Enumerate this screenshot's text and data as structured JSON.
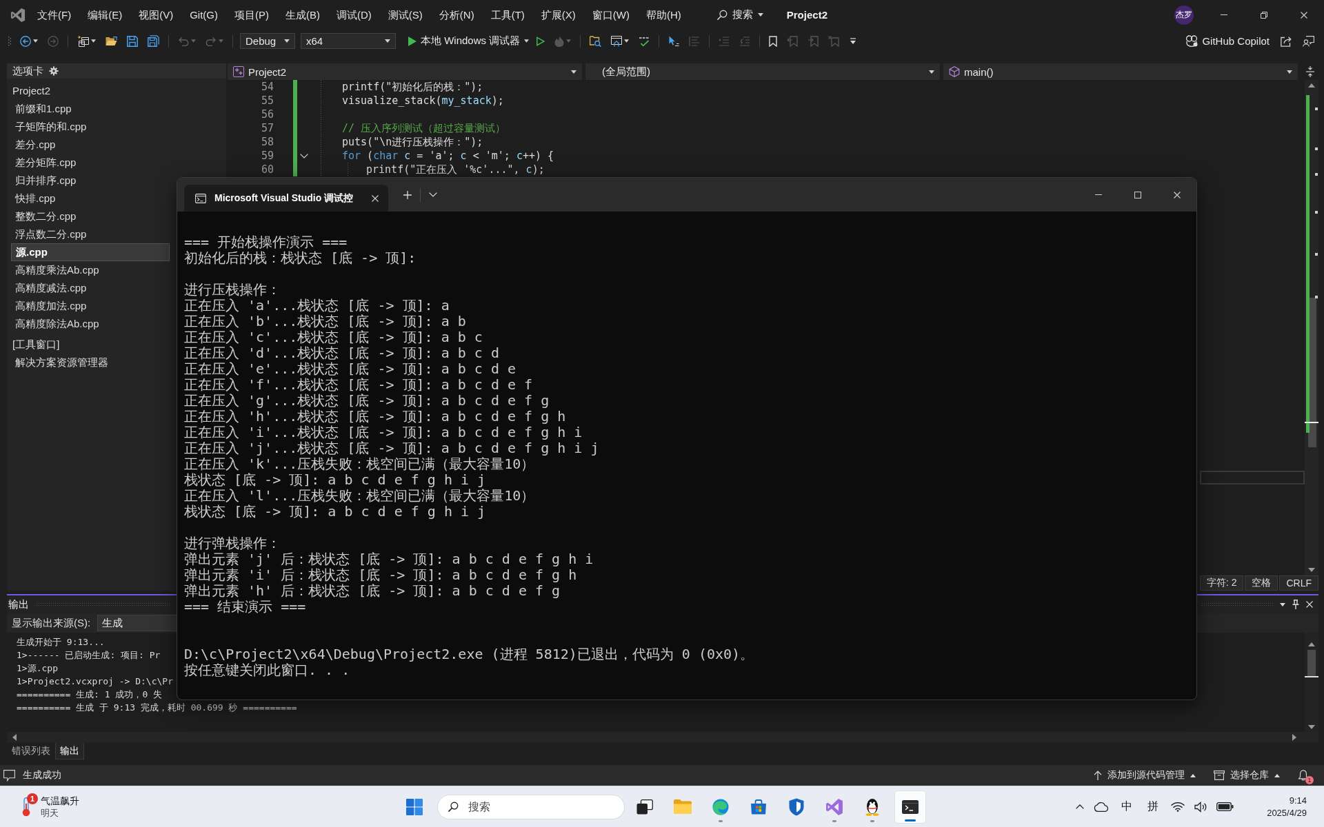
{
  "title_bar": {
    "menus": [
      "文件(F)",
      "编辑(E)",
      "视图(V)",
      "Git(G)",
      "项目(P)",
      "生成(B)",
      "调试(D)",
      "测试(S)",
      "分析(N)",
      "工具(T)",
      "扩展(X)",
      "窗口(W)",
      "帮助(H)"
    ],
    "search": "搜索",
    "solution": "Project2",
    "avatar": "杰罗"
  },
  "toolbar": {
    "file_buttons": [
      {
        "disabled": false
      },
      {
        "disabled": true
      },
      {
        "disabled": false
      },
      {
        "disabled": false
      },
      {
        "disabled": false
      },
      {
        "disabled": false
      },
      {
        "disabled": true
      },
      {
        "disabled": true
      }
    ],
    "configuration": "Debug",
    "platform": "x64",
    "start_button": "本地 Windows 调试器",
    "debug_buttons": [
      {
        "disabled": false
      },
      {
        "disabled": true
      },
      {
        "disabled": false
      },
      {
        "disabled": false
      },
      {
        "disabled": false
      },
      {
        "disabled": false
      },
      {
        "disabled": true
      },
      {
        "disabled": true
      },
      {
        "disabled": true
      },
      {
        "disabled": false
      },
      {
        "disabled": true
      },
      {
        "disabled": true
      },
      {
        "disabled": true
      }
    ],
    "copilot": "GitHub Copilot"
  },
  "sidebar": {
    "title": "选项卡",
    "tree": [
      {
        "label": "Project2",
        "selected": false,
        "children": [
          {
            "label": "前缀和1.cpp",
            "selected": false
          },
          {
            "label": "子矩阵的和.cpp",
            "selected": false
          },
          {
            "label": "差分.cpp",
            "selected": false
          },
          {
            "label": "差分矩阵.cpp",
            "selected": false
          },
          {
            "label": "归并排序.cpp",
            "selected": false
          },
          {
            "label": "快排.cpp",
            "selected": false
          },
          {
            "label": "整数二分.cpp",
            "selected": false
          },
          {
            "label": "浮点数二分.cpp",
            "selected": false
          },
          {
            "label": "源.cpp",
            "selected": true
          },
          {
            "label": "高精度乘法Ab.cpp",
            "selected": false
          },
          {
            "label": "高精度减法.cpp",
            "selected": false
          },
          {
            "label": "高精度加法.cpp",
            "selected": false
          },
          {
            "label": "高精度除法Ab.cpp",
            "selected": false
          }
        ]
      },
      {
        "label": "[工具窗口]",
        "selected": false,
        "children": [
          {
            "label": "解决方案资源管理器",
            "selected": false
          }
        ]
      }
    ]
  },
  "editor": {
    "navigation": {
      "project": "Project2",
      "scope": "(全局范围)",
      "member": "main()"
    },
    "lines": [
      {
        "number": "54",
        "tokens": [
          {
            "text": "printf(\"初始化后的栈：\");",
            "kind": "plain"
          }
        ]
      },
      {
        "number": "55",
        "tokens": [
          {
            "text": "visualize_stack(",
            "kind": "plain"
          },
          {
            "text": "my_stack",
            "kind": "variable"
          },
          {
            "text": ");",
            "kind": "plain"
          }
        ]
      },
      {
        "number": "56"
      },
      {
        "number": "57",
        "tokens": [
          {
            "text": "// 压入序列测试（超过容量测试）",
            "kind": "comment"
          }
        ]
      },
      {
        "number": "58",
        "tokens": [
          {
            "text": "puts(\"\\n进行压栈操作：\");",
            "kind": "plain"
          }
        ]
      },
      {
        "number": "59",
        "expanded": true,
        "tokens": [
          {
            "text": "for",
            "kind": "keyword"
          },
          {
            "text": " (",
            "kind": "plain"
          },
          {
            "text": "char",
            "kind": "keyword"
          },
          {
            "text": " c",
            "kind": "variable"
          },
          {
            "text": " = 'a'; ",
            "kind": "plain"
          },
          {
            "text": "c",
            "kind": "variable"
          },
          {
            "text": " < 'm'; ",
            "kind": "plain"
          },
          {
            "text": "c",
            "kind": "variable"
          },
          {
            "text": "++) {",
            "kind": "plain"
          }
        ],
        "children": [
          {
            "number": "60",
            "tokens": [
              {
                "text": "printf(\"正在压入 '%c'...\", ",
                "kind": "plain"
              },
              {
                "text": "c",
                "kind": "variable"
              },
              {
                "text": ");",
                "kind": "plain"
              }
            ]
          }
        ]
      }
    ],
    "status": {
      "position": "字符: 2",
      "indent": "空格",
      "line_ending": "CRLF"
    }
  },
  "output_panel": {
    "title": "输出",
    "source_label": "显示输出来源(S):",
    "source": "生成",
    "lines": [
      "生成开始于 9:13...",
      "1>------ 已启动生成: 项目: Pr",
      "1>源.cpp",
      "1>Project2.vcxproj -> D:\\c\\Pr",
      "========== 生成: 1 成功，0 失",
      "========== 生成 于 9:13 完成，耗时 00.699 秒 =========="
    ]
  },
  "bottom_tabs": [
    {
      "label": "错误列表",
      "selected": false
    },
    {
      "label": "输出",
      "selected": true
    }
  ],
  "console": {
    "tab_title": "Microsoft Visual Studio 调试控",
    "blocks": [
      {
        "kind": "output",
        "lines": [
          "=== 开始栈操作演示 ===",
          "初始化后的栈：栈状态 [底 -> 顶]:"
        ]
      },
      {
        "kind": "output",
        "lines": [
          "进行压栈操作：",
          "正在压入 'a'...栈状态 [底 -> 顶]: a",
          "正在压入 'b'...栈状态 [底 -> 顶]: a b",
          "正在压入 'c'...栈状态 [底 -> 顶]: a b c",
          "正在压入 'd'...栈状态 [底 -> 顶]: a b c d",
          "正在压入 'e'...栈状态 [底 -> 顶]: a b c d e",
          "正在压入 'f'...栈状态 [底 -> 顶]: a b c d e f",
          "正在压入 'g'...栈状态 [底 -> 顶]: a b c d e f g",
          "正在压入 'h'...栈状态 [底 -> 顶]: a b c d e f g h",
          "正在压入 'i'...栈状态 [底 -> 顶]: a b c d e f g h i",
          "正在压入 'j'...栈状态 [底 -> 顶]: a b c d e f g h i j",
          "正在压入 'k'...压栈失败：栈空间已满（最大容量10）",
          "栈状态 [底 -> 顶]: a b c d e f g h i j",
          "正在压入 'l'...压栈失败：栈空间已满（最大容量10）",
          "栈状态 [底 -> 顶]: a b c d e f g h i j"
        ]
      },
      {
        "kind": "output",
        "lines": [
          "进行弹栈操作：",
          "弹出元素 'j' 后：栈状态 [底 -> 顶]: a b c d e f g h i",
          "弹出元素 'i' 后：栈状态 [底 -> 顶]: a b c d e f g h",
          "弹出元素 'h' 后：栈状态 [底 -> 顶]: a b c d e f g",
          "=== 结束演示 ==="
        ]
      },
      {
        "kind": "exit",
        "lines": [
          "D:\\c\\Project2\\x64\\Debug\\Project2.exe (进程 5812)已退出，代码为 0 (0x0)。",
          "按任意键关闭此窗口. . ."
        ]
      }
    ]
  },
  "status_bar": {
    "message": "生成成功",
    "source_control": "添加到源代码管理",
    "repository": "选择仓库",
    "notifications": "1"
  },
  "taskbar": {
    "weather": {
      "badge": "1",
      "headline": "气温飙升",
      "detail": "明天"
    },
    "search": {
      "placeholder": "搜索"
    },
    "apps": [
      {
        "running": false,
        "selected": false
      },
      {
        "running": false,
        "selected": false
      },
      {
        "running": true,
        "selected": false
      },
      {
        "running": false,
        "selected": false
      },
      {
        "running": false,
        "selected": false
      },
      {
        "running": true,
        "selected": false
      },
      {
        "running": true,
        "selected": false
      },
      {
        "running": true,
        "selected": true
      }
    ],
    "input_mode": "中",
    "input_method": "拼",
    "clock": {
      "time": "9:14",
      "date": "2025/4/29"
    }
  }
}
